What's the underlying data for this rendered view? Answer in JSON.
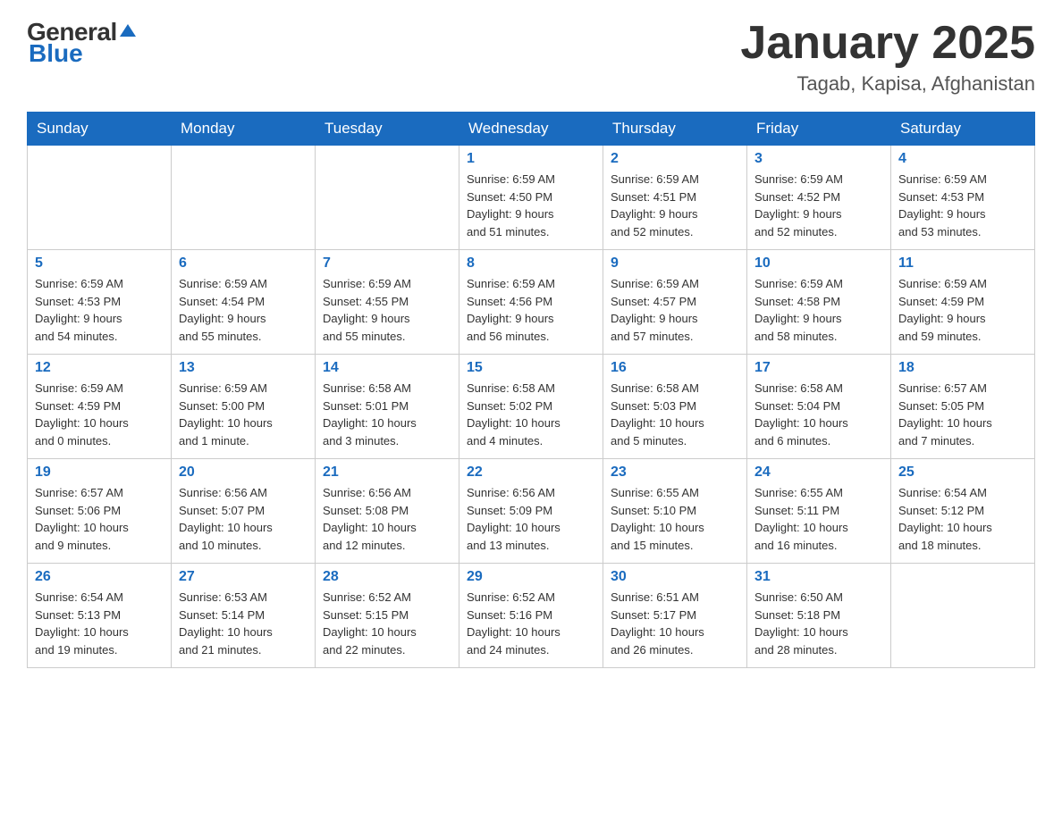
{
  "header": {
    "logo_general": "General",
    "logo_blue": "Blue",
    "month_title": "January 2025",
    "location": "Tagab, Kapisa, Afghanistan"
  },
  "weekdays": [
    "Sunday",
    "Monday",
    "Tuesday",
    "Wednesday",
    "Thursday",
    "Friday",
    "Saturday"
  ],
  "weeks": [
    [
      {
        "day": "",
        "info": ""
      },
      {
        "day": "",
        "info": ""
      },
      {
        "day": "",
        "info": ""
      },
      {
        "day": "1",
        "info": "Sunrise: 6:59 AM\nSunset: 4:50 PM\nDaylight: 9 hours\nand 51 minutes."
      },
      {
        "day": "2",
        "info": "Sunrise: 6:59 AM\nSunset: 4:51 PM\nDaylight: 9 hours\nand 52 minutes."
      },
      {
        "day": "3",
        "info": "Sunrise: 6:59 AM\nSunset: 4:52 PM\nDaylight: 9 hours\nand 52 minutes."
      },
      {
        "day": "4",
        "info": "Sunrise: 6:59 AM\nSunset: 4:53 PM\nDaylight: 9 hours\nand 53 minutes."
      }
    ],
    [
      {
        "day": "5",
        "info": "Sunrise: 6:59 AM\nSunset: 4:53 PM\nDaylight: 9 hours\nand 54 minutes."
      },
      {
        "day": "6",
        "info": "Sunrise: 6:59 AM\nSunset: 4:54 PM\nDaylight: 9 hours\nand 55 minutes."
      },
      {
        "day": "7",
        "info": "Sunrise: 6:59 AM\nSunset: 4:55 PM\nDaylight: 9 hours\nand 55 minutes."
      },
      {
        "day": "8",
        "info": "Sunrise: 6:59 AM\nSunset: 4:56 PM\nDaylight: 9 hours\nand 56 minutes."
      },
      {
        "day": "9",
        "info": "Sunrise: 6:59 AM\nSunset: 4:57 PM\nDaylight: 9 hours\nand 57 minutes."
      },
      {
        "day": "10",
        "info": "Sunrise: 6:59 AM\nSunset: 4:58 PM\nDaylight: 9 hours\nand 58 minutes."
      },
      {
        "day": "11",
        "info": "Sunrise: 6:59 AM\nSunset: 4:59 PM\nDaylight: 9 hours\nand 59 minutes."
      }
    ],
    [
      {
        "day": "12",
        "info": "Sunrise: 6:59 AM\nSunset: 4:59 PM\nDaylight: 10 hours\nand 0 minutes."
      },
      {
        "day": "13",
        "info": "Sunrise: 6:59 AM\nSunset: 5:00 PM\nDaylight: 10 hours\nand 1 minute."
      },
      {
        "day": "14",
        "info": "Sunrise: 6:58 AM\nSunset: 5:01 PM\nDaylight: 10 hours\nand 3 minutes."
      },
      {
        "day": "15",
        "info": "Sunrise: 6:58 AM\nSunset: 5:02 PM\nDaylight: 10 hours\nand 4 minutes."
      },
      {
        "day": "16",
        "info": "Sunrise: 6:58 AM\nSunset: 5:03 PM\nDaylight: 10 hours\nand 5 minutes."
      },
      {
        "day": "17",
        "info": "Sunrise: 6:58 AM\nSunset: 5:04 PM\nDaylight: 10 hours\nand 6 minutes."
      },
      {
        "day": "18",
        "info": "Sunrise: 6:57 AM\nSunset: 5:05 PM\nDaylight: 10 hours\nand 7 minutes."
      }
    ],
    [
      {
        "day": "19",
        "info": "Sunrise: 6:57 AM\nSunset: 5:06 PM\nDaylight: 10 hours\nand 9 minutes."
      },
      {
        "day": "20",
        "info": "Sunrise: 6:56 AM\nSunset: 5:07 PM\nDaylight: 10 hours\nand 10 minutes."
      },
      {
        "day": "21",
        "info": "Sunrise: 6:56 AM\nSunset: 5:08 PM\nDaylight: 10 hours\nand 12 minutes."
      },
      {
        "day": "22",
        "info": "Sunrise: 6:56 AM\nSunset: 5:09 PM\nDaylight: 10 hours\nand 13 minutes."
      },
      {
        "day": "23",
        "info": "Sunrise: 6:55 AM\nSunset: 5:10 PM\nDaylight: 10 hours\nand 15 minutes."
      },
      {
        "day": "24",
        "info": "Sunrise: 6:55 AM\nSunset: 5:11 PM\nDaylight: 10 hours\nand 16 minutes."
      },
      {
        "day": "25",
        "info": "Sunrise: 6:54 AM\nSunset: 5:12 PM\nDaylight: 10 hours\nand 18 minutes."
      }
    ],
    [
      {
        "day": "26",
        "info": "Sunrise: 6:54 AM\nSunset: 5:13 PM\nDaylight: 10 hours\nand 19 minutes."
      },
      {
        "day": "27",
        "info": "Sunrise: 6:53 AM\nSunset: 5:14 PM\nDaylight: 10 hours\nand 21 minutes."
      },
      {
        "day": "28",
        "info": "Sunrise: 6:52 AM\nSunset: 5:15 PM\nDaylight: 10 hours\nand 22 minutes."
      },
      {
        "day": "29",
        "info": "Sunrise: 6:52 AM\nSunset: 5:16 PM\nDaylight: 10 hours\nand 24 minutes."
      },
      {
        "day": "30",
        "info": "Sunrise: 6:51 AM\nSunset: 5:17 PM\nDaylight: 10 hours\nand 26 minutes."
      },
      {
        "day": "31",
        "info": "Sunrise: 6:50 AM\nSunset: 5:18 PM\nDaylight: 10 hours\nand 28 minutes."
      },
      {
        "day": "",
        "info": ""
      }
    ]
  ]
}
